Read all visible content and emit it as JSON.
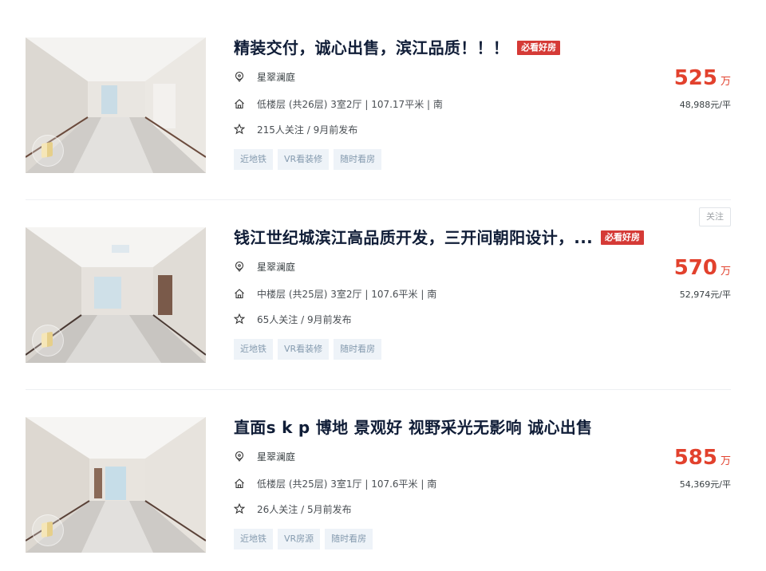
{
  "listings": [
    {
      "title": "精装交付，诚心出售，滨江品质！！！",
      "badge": "必看好房",
      "community": "星翠澜庭",
      "house_info": "低楼层 (共26层) 3室2厅 | 107.17平米 | 南",
      "follow_info": "215人关注 / 9月前发布",
      "tags": [
        "近地铁",
        "VR看装修",
        "随时看房"
      ],
      "total_price": "525",
      "total_unit": "万",
      "unit_price": "48,988元/平"
    },
    {
      "title": "钱江世纪城滨江高品质开发，三开间朝阳设计，...",
      "badge": "必看好房",
      "community": "星翠澜庭",
      "house_info": "中楼层 (共25层) 3室2厅 | 107.6平米 | 南",
      "follow_info": "65人关注 / 9月前发布",
      "tags": [
        "近地铁",
        "VR看装修",
        "随时看房"
      ],
      "total_price": "570",
      "total_unit": "万",
      "unit_price": "52,974元/平"
    },
    {
      "title": "直面s k p 博地 景观好 视野采光无影响 诚心出售",
      "badge": "",
      "community": "星翠澜庭",
      "house_info": "低楼层 (共25层) 3室1厅 | 107.6平米 | 南",
      "follow_info": "26人关注 / 5月前发布",
      "tags": [
        "近地铁",
        "VR房源",
        "随时看房"
      ],
      "total_price": "585",
      "total_unit": "万",
      "unit_price": "54,369元/平"
    }
  ],
  "follow_button": "关注",
  "colors": {
    "price": "#e2412d",
    "badge_bg": "#d53a36",
    "title": "#101d37",
    "tag_bg": "#eef3f8",
    "tag_text": "#849aae"
  },
  "icons": {
    "community": "location-pin-icon",
    "house_info": "house-icon",
    "follow_info": "star-icon"
  }
}
